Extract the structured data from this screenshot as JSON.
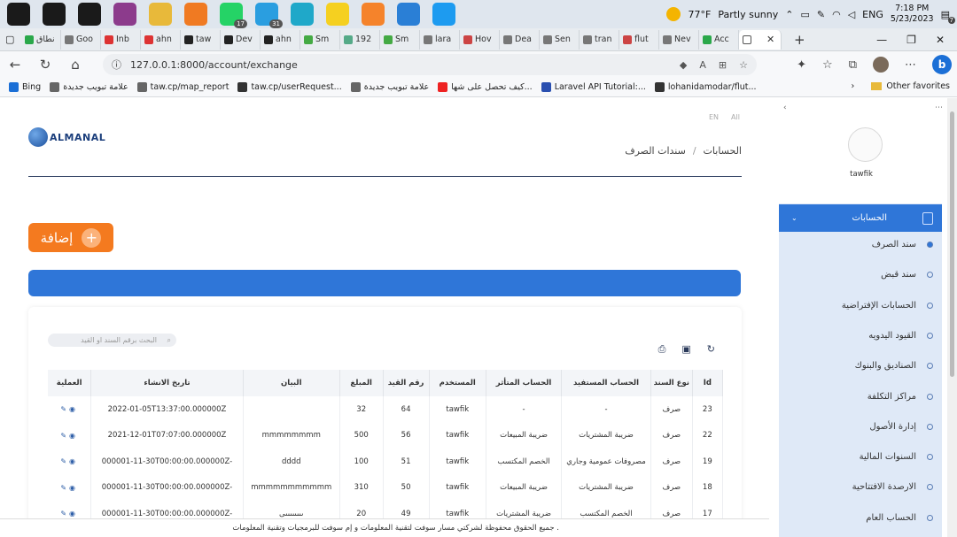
{
  "taskbar": {
    "apps": [
      {
        "icon": "windows-start-icon",
        "color": "#1a1a1a"
      },
      {
        "icon": "search-icon",
        "color": "#1a1a1a"
      },
      {
        "icon": "task-view-icon",
        "color": "#1a1a1a"
      },
      {
        "icon": "winrar-icon",
        "color": "#8c3b8c"
      },
      {
        "icon": "file-explorer-icon",
        "color": "#e8b93a"
      },
      {
        "icon": "xampp-icon",
        "color": "#f07a22"
      },
      {
        "icon": "whatsapp-icon",
        "color": "#25d366",
        "badge": "17"
      },
      {
        "icon": "telegram-icon",
        "color": "#2a9ee0",
        "badge": "31"
      },
      {
        "icon": "edge-icon",
        "color": "#1fa8c9"
      },
      {
        "icon": "sticky-notes-icon",
        "color": "#f5d020"
      },
      {
        "icon": "postman-icon",
        "color": "#f5832b"
      },
      {
        "icon": "vscode-icon",
        "color": "#2a7fd6"
      },
      {
        "icon": "twitter-icon",
        "color": "#1d9bf0"
      }
    ],
    "weather": {
      "temp": "77°F",
      "desc": "Partly sunny"
    },
    "lang": "ENG",
    "time": "7:18 PM",
    "date": "5/23/2023",
    "notif_count": "7"
  },
  "tabs": [
    {
      "label": "نطاق",
      "color": "#2aa84a"
    },
    {
      "label": "Goo",
      "color": "#777"
    },
    {
      "label": "Inb",
      "color": "#d33"
    },
    {
      "label": "ahn",
      "color": "#d33"
    },
    {
      "label": "taw",
      "color": "#222"
    },
    {
      "label": "Dev",
      "color": "#222"
    },
    {
      "label": "ahn",
      "color": "#222"
    },
    {
      "label": "Sm",
      "color": "#4a4"
    },
    {
      "label": "192",
      "color": "#5a8"
    },
    {
      "label": "Sm",
      "color": "#4a4"
    },
    {
      "label": "lara",
      "color": "#777"
    },
    {
      "label": "Hov",
      "color": "#c44"
    },
    {
      "label": "Dea",
      "color": "#777"
    },
    {
      "label": "Sen",
      "color": "#777"
    },
    {
      "label": "tran",
      "color": "#777"
    },
    {
      "label": "flut",
      "color": "#c44"
    },
    {
      "label": "Nev",
      "color": "#777"
    },
    {
      "label": "Acc",
      "color": "#2aa84a"
    }
  ],
  "address": {
    "url": "127.0.0.1:8000/account/exchange"
  },
  "bookmarks": [
    {
      "label": "Bing",
      "color": "#1b6fd6"
    },
    {
      "label": "علامة تبويب جديدة",
      "color": "#666"
    },
    {
      "label": "taw.cp/map_report",
      "color": "#666"
    },
    {
      "label": "taw.cp/userRequest...",
      "color": "#333"
    },
    {
      "label": "علامة تبويب جديدة",
      "color": "#666"
    },
    {
      "label": "كيف تحصل على شها...",
      "color": "#e22"
    },
    {
      "label": "Laravel API Tutorial:...",
      "color": "#2a4fb0"
    },
    {
      "label": "lohanidamodar/flut...",
      "color": "#333"
    }
  ],
  "other_favorites": "Other favorites",
  "page": {
    "lang_links": [
      "EN",
      "All"
    ],
    "logo_text": "ALMANAL",
    "breadcrumb": {
      "root": "الحسابات",
      "sep": "/",
      "current": "سندات الصرف"
    },
    "add_button": "إضافة",
    "search_placeholder": "البحث برقم السند او القيد",
    "table": {
      "headers": [
        "Id",
        "نوع السند",
        "الحساب المستفيد",
        "الحساب المتأثر",
        "المستخدم",
        "رقم القيد",
        "المبلغ",
        "البيان",
        "تاريخ الانشاء",
        "العملية"
      ],
      "rows": [
        [
          "23",
          "صرف",
          "-",
          "-",
          "tawfik",
          "64",
          "32",
          "",
          "2022-01-05T13:37:00.000000Z"
        ],
        [
          "22",
          "صرف",
          "ضريبة المشتريات",
          "ضريبة المبيعات",
          "tawfik",
          "56",
          "500",
          "mmmmmmmm",
          "2021-12-01T07:07:00.000000Z"
        ],
        [
          "19",
          "صرف",
          "مصروفات عمومية وجاري",
          "الخصم المكتسب",
          "tawfik",
          "51",
          "100",
          "dddd",
          "000001-11-30T00:00:00.000000Z-"
        ],
        [
          "18",
          "صرف",
          "ضريبة المشتريات",
          "ضريبة المبيعات",
          "tawfik",
          "50",
          "310",
          "mmmmmmmmmmm",
          "000001-11-30T00:00:00.000000Z-"
        ],
        [
          "17",
          "صرف",
          "الخصم المكتسب",
          "ضريبة المشتريات",
          "tawfik",
          "49",
          "20",
          "ىىىىىىىىى",
          "000001-11-30T00:00:00.000000Z-"
        ]
      ]
    },
    "footer": "جميع الحقوق محفوظة لشركتي مسار سوفت لتقنية المعلومات و إم سوفت للبرمجيات وتقنية المعلومات ."
  },
  "sidebar": {
    "user_name": "tawfik",
    "menu_head": "الحسابات",
    "items": [
      {
        "label": "سند الصرف",
        "active": true
      },
      {
        "label": "سند قبض",
        "active": false
      },
      {
        "label": "الحسابات الإفتراضية",
        "active": false
      },
      {
        "label": "القيود اليدويه",
        "active": false
      },
      {
        "label": "الصناديق والبنوك",
        "active": false
      },
      {
        "label": "مراكز التكلفة",
        "active": false
      },
      {
        "label": "إدارة الأصول",
        "active": false
      },
      {
        "label": "السنوات المالية",
        "active": false
      },
      {
        "label": "الارصدة الافتتاحية",
        "active": false
      },
      {
        "label": "الحساب العام",
        "active": false
      }
    ]
  }
}
